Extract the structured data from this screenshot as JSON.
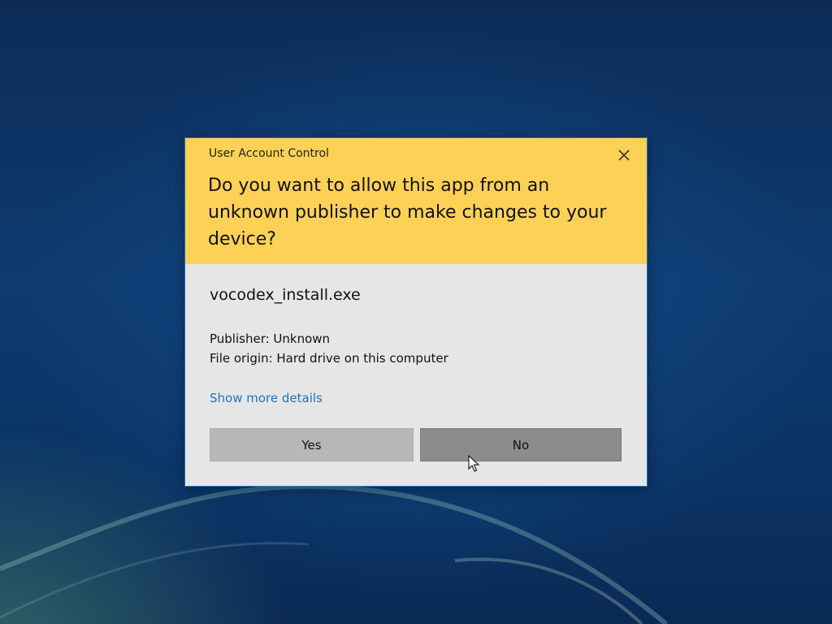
{
  "dialog": {
    "title": "User Account Control",
    "question": "Do you want to allow this app from an unknown publisher to make changes to your device?",
    "app_name": "vocodex_install.exe",
    "publisher_line": "Publisher: Unknown",
    "origin_line": "File origin: Hard drive on this computer",
    "details_link": "Show more details",
    "yes_label": "Yes",
    "no_label": "No",
    "close_icon": "close-x-icon"
  },
  "colors": {
    "header_bg": "#fcd155",
    "body_bg": "#e6e6e6",
    "link": "#1c74c4",
    "yes_button_bg": "#b7b7b7",
    "no_button_bg": "#8c8c8c",
    "desktop_bg": "#0e3a70"
  }
}
